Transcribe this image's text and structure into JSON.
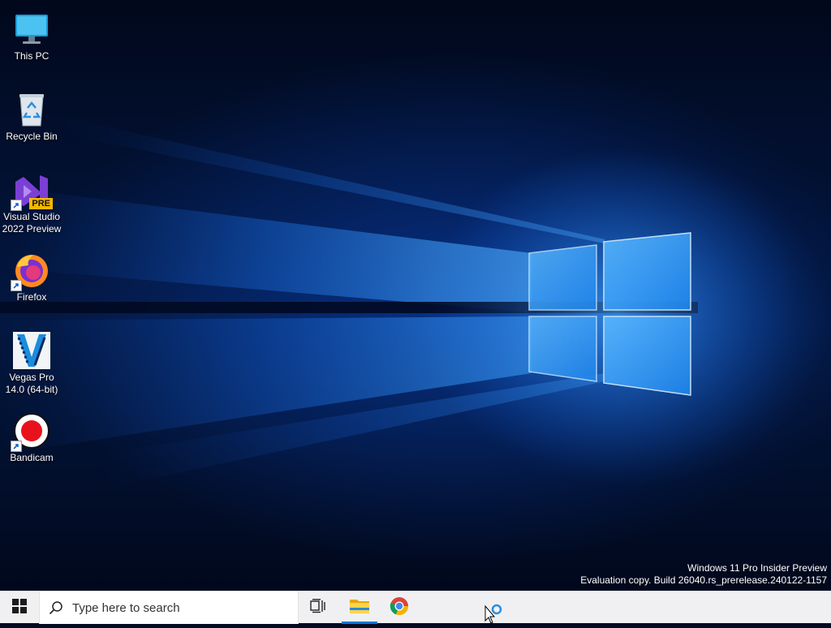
{
  "desktop": {
    "icons": [
      {
        "label": "This PC",
        "icon": "monitor-icon"
      },
      {
        "label": "Recycle Bin",
        "icon": "recycle-bin-icon"
      },
      {
        "label": "Visual Studio\n2022 Preview",
        "icon": "visual-studio-icon",
        "badge": "PRE"
      },
      {
        "label": "Firefox",
        "icon": "firefox-icon"
      },
      {
        "label": "Vegas Pro\n14.0 (64-bit)",
        "icon": "vegas-pro-icon"
      },
      {
        "label": "Bandicam",
        "icon": "bandicam-icon"
      }
    ],
    "watermark": {
      "line1": "Windows 11 Pro Insider Preview",
      "line2": "Evaluation copy. Build 26040.rs_prerelease.240122-1157"
    }
  },
  "taskbar": {
    "start_icon": "windows-logo-icon",
    "search": {
      "placeholder": "Type here to search",
      "icon": "search-icon"
    },
    "pinned": [
      {
        "name": "Task View",
        "icon": "task-view-icon"
      },
      {
        "name": "File Explorer",
        "icon": "folder-icon",
        "active": true
      },
      {
        "name": "Google Chrome",
        "icon": "chrome-icon"
      }
    ]
  },
  "colors": {
    "accent": "#0078d4",
    "taskbar_bg": "#f0f0f2",
    "wallpaper_glow": "#1a7fe8"
  }
}
